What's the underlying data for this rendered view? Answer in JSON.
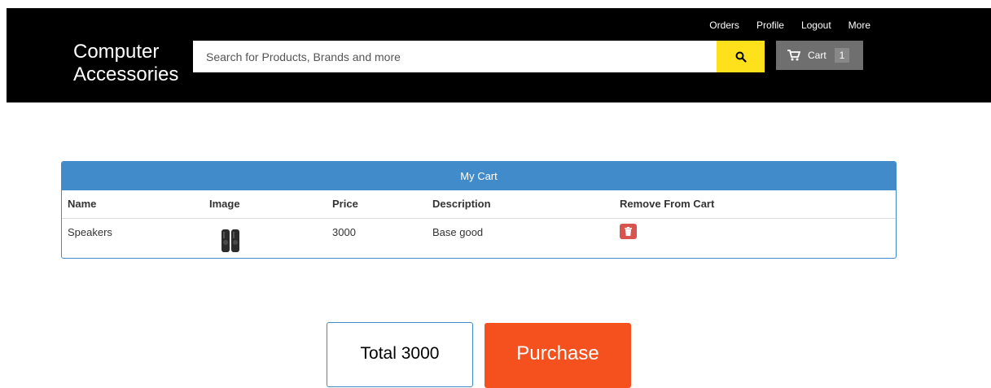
{
  "header": {
    "brand": "Computer\nAccessories",
    "brand_line1": "Computer",
    "brand_line2": "Accessories",
    "nav_links": [
      "Orders",
      "Profile",
      "Logout",
      "More"
    ],
    "search": {
      "placeholder": "Search for Products, Brands and more",
      "value": "",
      "icon": "search-icon"
    },
    "cart": {
      "label": "Cart",
      "count": "1",
      "icon": "cart-icon"
    }
  },
  "cart_panel": {
    "title": "My Cart",
    "columns": [
      "Name",
      "Image",
      "Price",
      "Description",
      "Remove From Cart"
    ],
    "rows": [
      {
        "name": "Speakers",
        "image": "speakers-image",
        "price": "3000",
        "description": "Base good",
        "remove_icon": "trash-icon"
      }
    ]
  },
  "summary": {
    "total_label": "Total 3000",
    "purchase_label": "Purchase"
  },
  "colors": {
    "header_bg": "#000000",
    "search_button": "#ffe11b",
    "cart_button": "#6f6f6f",
    "panel_primary": "#428bca",
    "danger": "#d9534f",
    "purchase": "#f4511e"
  }
}
